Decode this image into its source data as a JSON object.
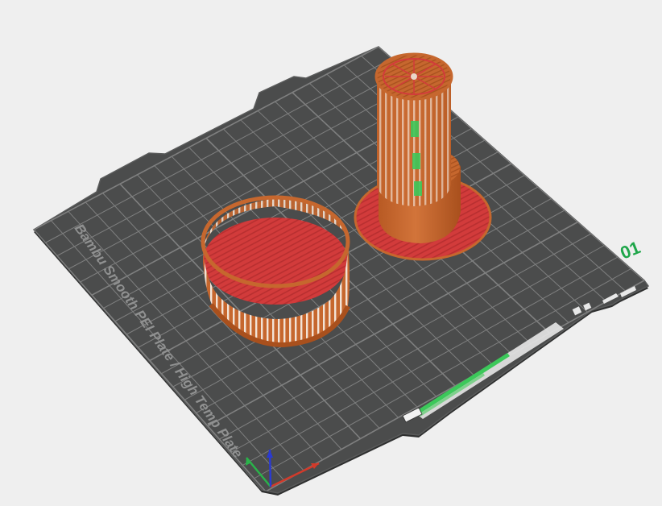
{
  "scene": {
    "plate_label": "Bambu Smooth PEI Plate / High Temp Plate",
    "plate_number": "01"
  },
  "colors": {
    "background": "#efefef",
    "plate": "#4b4c4c",
    "plate_edge": "#2f3030",
    "grid": "#8a8b8b",
    "filament_orange": "#c6672e",
    "filament_red": "#d23b3b",
    "preview_green": "#3cc85a",
    "label_green": "#1fa64a",
    "axis_x": "#d23a2a",
    "axis_y": "#2ab34a",
    "axis_z": "#2a3ad2"
  },
  "icons": [
    "plate-settings-icon",
    "lock-icon",
    "orient-icon",
    "auto-arrange-icon",
    "axis-gizmo-icon"
  ]
}
